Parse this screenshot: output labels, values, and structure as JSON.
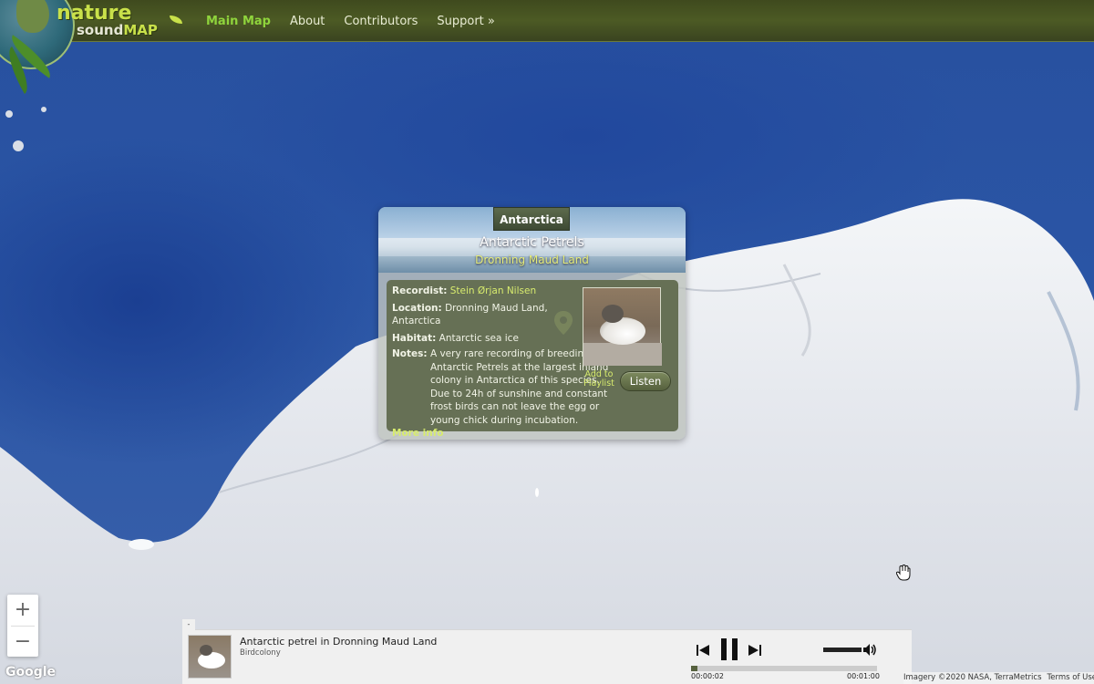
{
  "header": {
    "logo_word1": "nature",
    "logo_word2a": "sound",
    "logo_word2b": "MAP",
    "nav": [
      {
        "label": "Main Map",
        "active": true
      },
      {
        "label": "About",
        "active": false
      },
      {
        "label": "Contributors",
        "active": false
      },
      {
        "label": "Support »",
        "active": false
      }
    ]
  },
  "popup": {
    "region_tab": "Antarctica",
    "title": "Antarctic Petrels",
    "subtitle": "Dronning Maud Land",
    "recordist_label": "Recordist:",
    "recordist": "Stein Ørjan Nilsen",
    "location_label": "Location:",
    "location": "Dronning Maud Land, Antarctica",
    "habitat_label": "Habitat:",
    "habitat": "Antarctic sea ice",
    "notes_label": "Notes:",
    "notes": "A very rare recording of breeding Antarctic Petrels at the largest inland colony in Antarctica of this species. Due to 24h of sunshine and constant frost birds can not leave the egg or young chick during incubation.",
    "more_info": "More info",
    "add_to_playlist": "Add to Playlist",
    "listen": "Listen"
  },
  "map": {
    "zoom_in": "+",
    "zoom_out": "−",
    "google": "Google",
    "attribution": "Imagery ©2020 NASA, TerraMetrics",
    "terms": "Terms of Use"
  },
  "player": {
    "collapse": "-",
    "track_title": "Antarctic petrel in Dronning Maud Land",
    "track_subtitle": "Birdcolony",
    "elapsed": "00:00:02",
    "duration": "00:01:00",
    "progress": 0.033,
    "volume": 1.0
  },
  "colors": {
    "header_bg": "#4c5a24",
    "nav_active": "#8fd43c",
    "accent_yellow": "#d8ec6e",
    "ocean": "#2a55a5",
    "ice": "#e8eaef"
  }
}
